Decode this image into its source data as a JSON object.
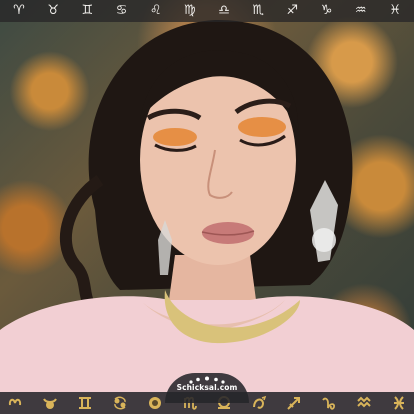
{
  "zodiac_signs": [
    {
      "glyph": "♈",
      "icon": "aries-icon"
    },
    {
      "glyph": "♉",
      "icon": "taurus-icon"
    },
    {
      "glyph": "♊",
      "icon": "gemini-icon"
    },
    {
      "glyph": "♋",
      "icon": "cancer-icon"
    },
    {
      "glyph": "♌",
      "icon": "leo-icon"
    },
    {
      "glyph": "♍",
      "icon": "virgo-icon"
    },
    {
      "glyph": "♎",
      "icon": "libra-icon"
    },
    {
      "glyph": "♏",
      "icon": "scorpio-icon"
    },
    {
      "glyph": "♐",
      "icon": "sagittarius-icon"
    },
    {
      "glyph": "♑",
      "icon": "capricorn-icon"
    },
    {
      "glyph": "♒",
      "icon": "aquarius-icon"
    },
    {
      "glyph": "♓",
      "icon": "pisces-icon"
    }
  ],
  "logo": {
    "text": "Schicksal.com"
  },
  "bottom_icons": [
    "aries-gold-icon",
    "taurus-gold-icon",
    "gemini-gold-icon",
    "cancer-gold-icon",
    "leo-gold-icon",
    "virgo-gold-icon",
    "libra-gold-icon",
    "scorpio-gold-icon",
    "sagittarius-gold-icon",
    "capricorn-gold-icon",
    "aquarius-gold-icon",
    "pisces-gold-icon"
  ],
  "colors": {
    "bar_background": "#282628",
    "sign_color": "#f3f1ee",
    "gold": "#d9b45a",
    "logo_dot": "#ffffff"
  }
}
